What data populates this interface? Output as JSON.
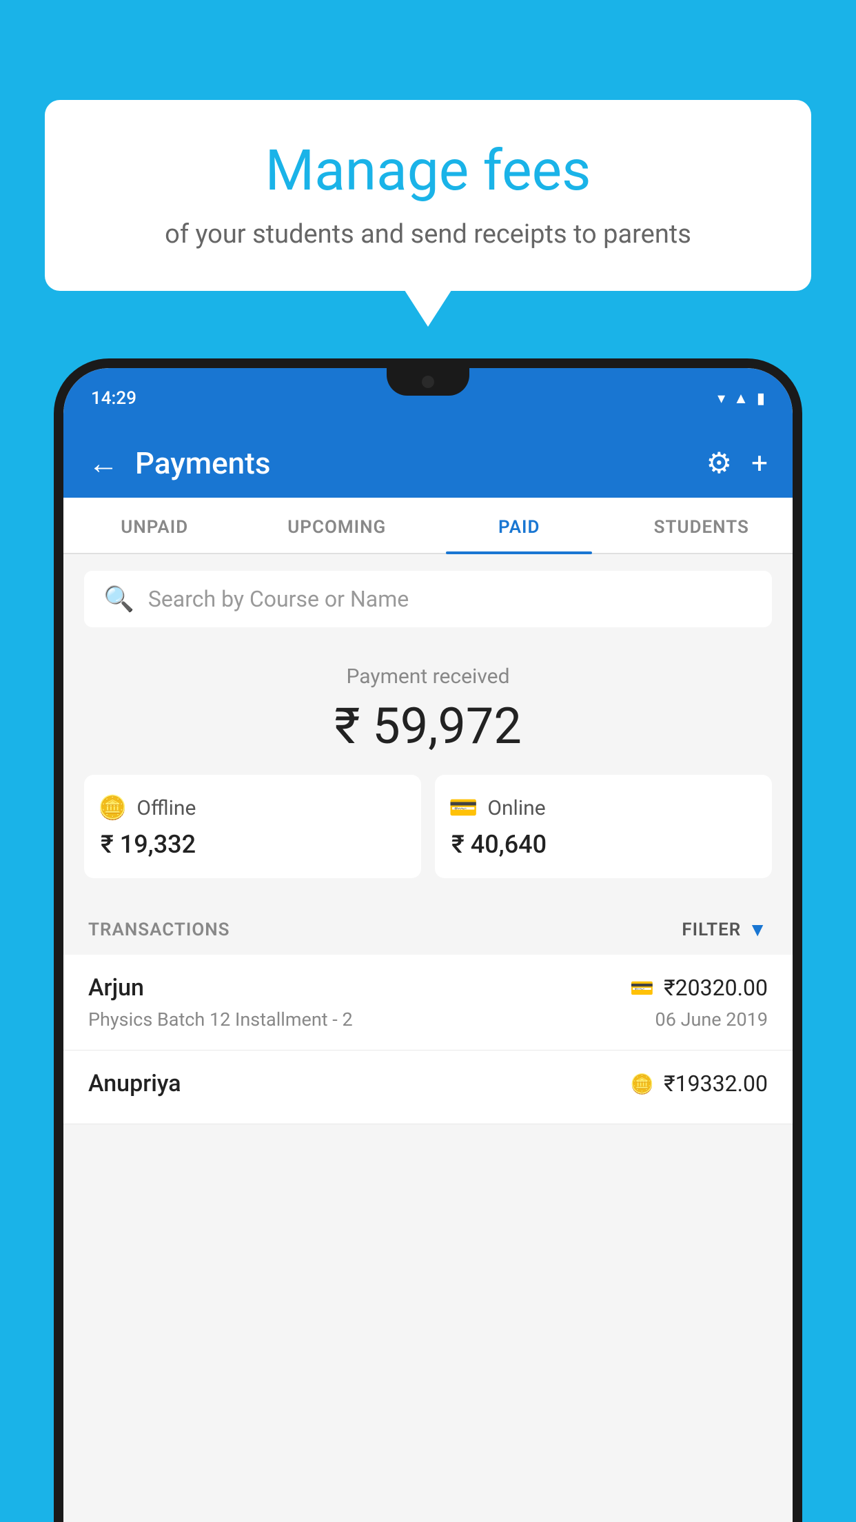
{
  "background_color": "#1ab3e8",
  "speech_bubble": {
    "title": "Manage fees",
    "subtitle": "of your students and send receipts to parents"
  },
  "status_bar": {
    "time": "14:29",
    "icons": [
      "wifi",
      "signal",
      "battery"
    ]
  },
  "header": {
    "title": "Payments",
    "back_label": "←",
    "settings_label": "⚙",
    "add_label": "+"
  },
  "tabs": [
    {
      "id": "unpaid",
      "label": "UNPAID",
      "active": false
    },
    {
      "id": "upcoming",
      "label": "UPCOMING",
      "active": false
    },
    {
      "id": "paid",
      "label": "PAID",
      "active": true
    },
    {
      "id": "students",
      "label": "STUDENTS",
      "active": false
    }
  ],
  "search": {
    "placeholder": "Search by Course or Name"
  },
  "payment_summary": {
    "label": "Payment received",
    "amount": "₹ 59,972",
    "offline": {
      "icon": "₹-box",
      "label": "Offline",
      "amount": "₹ 19,332"
    },
    "online": {
      "icon": "card",
      "label": "Online",
      "amount": "₹ 40,640"
    }
  },
  "transactions": {
    "label": "TRANSACTIONS",
    "filter_label": "FILTER",
    "rows": [
      {
        "name": "Arjun",
        "course": "Physics Batch 12 Installment - 2",
        "amount": "₹20320.00",
        "date": "06 June 2019",
        "method": "card"
      },
      {
        "name": "Anupriya",
        "course": "",
        "amount": "₹19332.00",
        "date": "",
        "method": "cash"
      }
    ]
  }
}
